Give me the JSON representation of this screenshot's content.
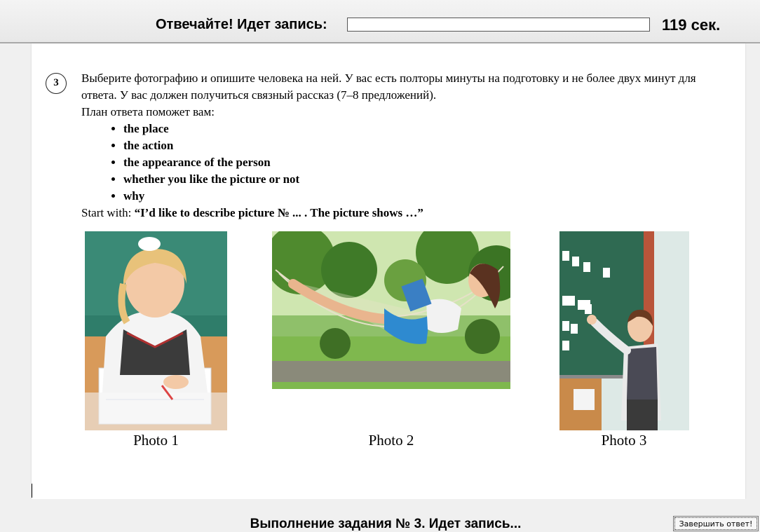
{
  "header": {
    "recording_label": "Отвечайте! Идет запись:",
    "recording_progress": 0,
    "seconds_left": "119 сек."
  },
  "task": {
    "number": "3",
    "instruction_line1": "Выберите фотографию и опишите человека на ней. У вас есть полторы минуты на подготовку и не более двух минут для ответа. У вас должен получиться связный рассказ (7–8 предложений).",
    "plan_intro": "План ответа поможет вам:",
    "plan": [
      "the place",
      "the action",
      "the appearance of the person",
      "whether you like the picture or not",
      "why"
    ],
    "start_prefix": "Start with: ",
    "start_phrase": "“I’d like to describe picture № ... . The picture shows …”"
  },
  "photos": [
    {
      "caption": "Photo 1"
    },
    {
      "caption": "Photo 2"
    },
    {
      "caption": "Photo 3"
    }
  ],
  "footer": {
    "status": "Выполнение задания № 3. Идет запись...",
    "finish_button": "Завершить ответ!"
  }
}
